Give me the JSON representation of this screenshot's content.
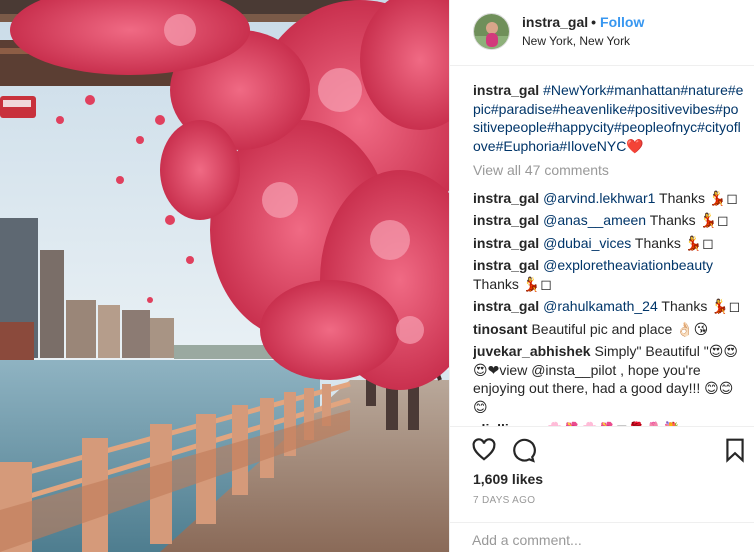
{
  "header": {
    "username": "instra_gal",
    "dot": "•",
    "follow_label": "Follow",
    "location": "New York, New York"
  },
  "caption": {
    "username": "instra_gal",
    "text": "#NewYork#manhattan#nature#epic#paradise#heavenlike#positivevibes#positivepeople#happycity#peopleofnyc#cityoflove#Euphoria#IloveNYC❤️"
  },
  "view_all_label": "View all 47 comments",
  "comments": [
    {
      "username": "instra_gal",
      "mention": "@arvind.lekhwar1",
      "text": " Thanks 💃◻"
    },
    {
      "username": "instra_gal",
      "mention": "@anas__ameen",
      "text": " Thanks 💃◻"
    },
    {
      "username": "instra_gal",
      "mention": "@dubai_vices",
      "text": " Thanks 💃◻"
    },
    {
      "username": "instra_gal",
      "mention": "@exploretheaviationbeauty",
      "text": " Thanks 💃◻"
    },
    {
      "username": "instra_gal",
      "mention": "@rahulkamath_24",
      "text": " Thanks 💃◻"
    },
    {
      "username": "tinosant",
      "mention": "",
      "text": "Beautiful pic and place 👌🏻😘"
    },
    {
      "username": "juvekar_abhishek",
      "mention": "",
      "text": "Simply\" Beautiful \"😍😍😍❤view @insta__pilot , hope you're enjoying out there, had a good day!!! 😊😊😊"
    },
    {
      "username": "oliallinone",
      "mention": "",
      "text": "🌸🌺🌸🌺◻🌹🌷💐"
    }
  ],
  "actions": {
    "like_icon": "heart-icon",
    "comment_icon": "comment-bubble-icon",
    "save_icon": "bookmark-icon"
  },
  "likes": "1,609 likes",
  "time_ago": "7 DAYS AGO",
  "add_comment_placeholder": "Add a comment...",
  "colors": {
    "link": "#003569",
    "follow": "#3897f0",
    "muted": "#999999",
    "blossom": "#e0405e"
  }
}
